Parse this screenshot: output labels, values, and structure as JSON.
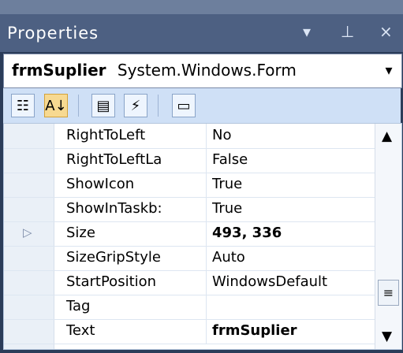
{
  "panel": {
    "title": "Properties"
  },
  "object": {
    "name": "frmSuplier",
    "type": "System.Windows.Form",
    "dropdown_label": "▾"
  },
  "toolbar": {
    "categorized": "☷",
    "alphabetical": "A↓",
    "properties": "▤",
    "events": "⚡",
    "property_pages": "▭"
  },
  "properties": [
    {
      "name": "RightToLeft",
      "value": "No",
      "bold": false,
      "expander": ""
    },
    {
      "name": "RightToLeftLa",
      "value": "False",
      "bold": false,
      "expander": ""
    },
    {
      "name": "ShowIcon",
      "value": "True",
      "bold": false,
      "expander": ""
    },
    {
      "name": "ShowInTaskb:",
      "value": "True",
      "bold": false,
      "expander": ""
    },
    {
      "name": "Size",
      "value": "493, 336",
      "bold": true,
      "expander": "▷"
    },
    {
      "name": "SizeGripStyle",
      "value": "Auto",
      "bold": false,
      "expander": ""
    },
    {
      "name": "StartPosition",
      "value": "WindowsDefault",
      "bold": false,
      "expander": ""
    },
    {
      "name": "Tag",
      "value": "",
      "bold": false,
      "expander": ""
    },
    {
      "name": "Text",
      "value": "frmSuplier",
      "bold": true,
      "expander": ""
    }
  ],
  "scrollbar": {
    "up_label": "▲",
    "down_label": "▼",
    "thumb_label": "≡"
  },
  "window_controls": {
    "menu_label": "▾",
    "pin_label": "⊥",
    "close_label": "×"
  }
}
